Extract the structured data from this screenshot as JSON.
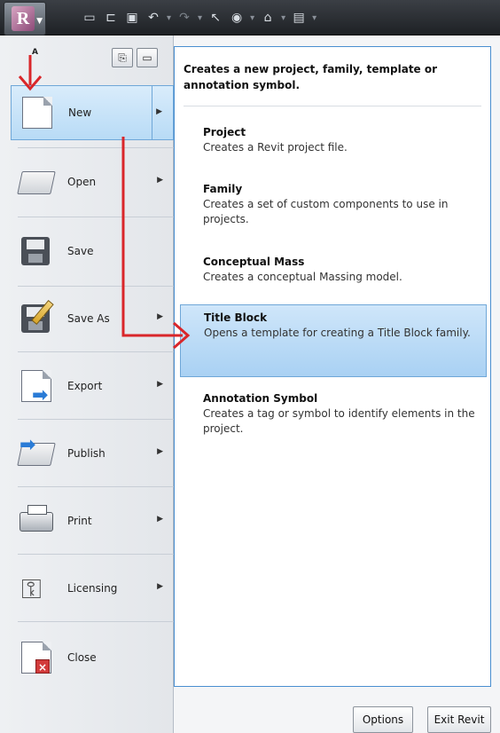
{
  "toolbar": {
    "app_letter": "R",
    "badge": "A",
    "icons": [
      "new-icon",
      "open-icon",
      "save-icon",
      "undo-icon",
      "redo-icon",
      "select-icon",
      "measure-icon",
      "3d-view-icon",
      "switch-windows-icon",
      "customize-icon"
    ]
  },
  "menu": {
    "items": [
      {
        "label": "New",
        "icon": "new-page-icon",
        "has_arrow": true
      },
      {
        "label": "Open",
        "icon": "folder-icon",
        "has_arrow": true
      },
      {
        "label": "Save",
        "icon": "floppy-icon",
        "has_arrow": false
      },
      {
        "label": "Save As",
        "icon": "save-as-icon",
        "has_arrow": true
      },
      {
        "label": "Export",
        "icon": "export-icon",
        "has_arrow": true
      },
      {
        "label": "Publish",
        "icon": "publish-icon",
        "has_arrow": true
      },
      {
        "label": "Print",
        "icon": "printer-icon",
        "has_arrow": true
      },
      {
        "label": "Licensing",
        "icon": "key-icon",
        "has_arrow": true
      },
      {
        "label": "Close",
        "icon": "close-doc-icon",
        "has_arrow": false
      }
    ]
  },
  "submenu": {
    "header": "Creates a new project, family, template or annotation symbol.",
    "items": [
      {
        "title": "Project",
        "desc": "Creates a Revit project file."
      },
      {
        "title": "Family",
        "desc": "Creates a set of custom components to use in projects."
      },
      {
        "title": "Conceptual Mass",
        "desc": "Creates a conceptual Massing model."
      },
      {
        "title": "Title Block",
        "desc": "Opens a template for creating a Title Block family."
      },
      {
        "title": "Annotation Symbol",
        "desc": "Creates a tag or symbol to identify elements in the project."
      }
    ]
  },
  "footer": {
    "options_label": "Options",
    "exit_label": "Exit Revit"
  },
  "colors": {
    "accent": "#4a8fd0",
    "highlight": "#b8dbf6",
    "annotation_arrow": "#d9262a"
  }
}
